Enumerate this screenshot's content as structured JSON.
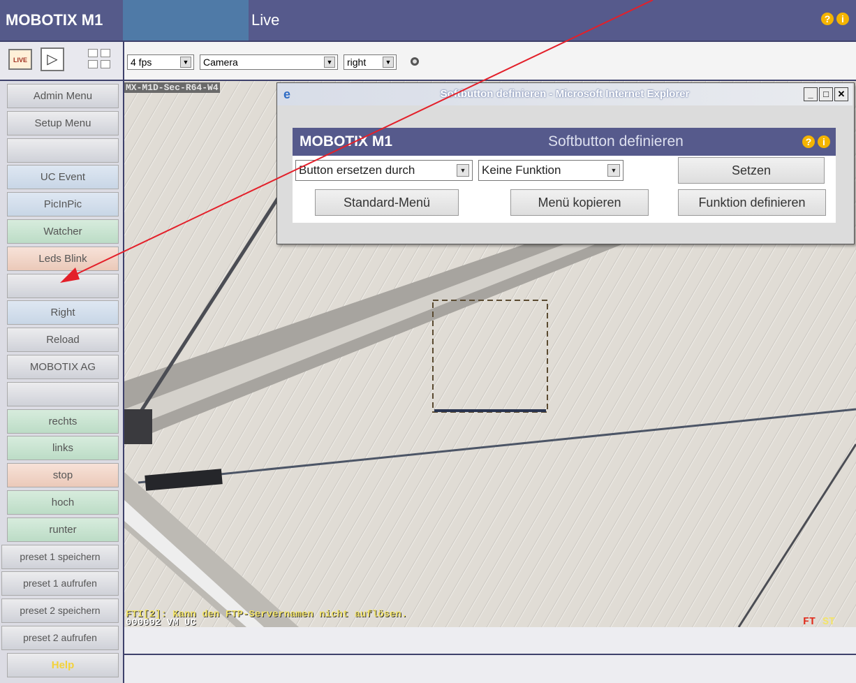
{
  "header": {
    "brand": "MOBOTIX M1",
    "title": "Live",
    "icons": [
      "help-icon",
      "info-icon"
    ]
  },
  "toolbar": {
    "live_label": "LIVE",
    "fps": "4 fps",
    "source": "Camera",
    "position": "right"
  },
  "sidebar": {
    "items": [
      {
        "label": "Admin Menu",
        "style": "gray"
      },
      {
        "label": "Setup Menu",
        "style": "gray"
      },
      {
        "label": "",
        "style": "gray"
      },
      {
        "label": "UC Event",
        "style": "blue"
      },
      {
        "label": "PicInPic",
        "style": "blue"
      },
      {
        "label": "Watcher",
        "style": "green"
      },
      {
        "label": "Leds Blink",
        "style": "pink"
      },
      {
        "label": "",
        "style": "gray"
      },
      {
        "label": "Right",
        "style": "blue"
      },
      {
        "label": "Reload",
        "style": "gray"
      },
      {
        "label": "MOBOTIX AG",
        "style": "gray"
      },
      {
        "label": "",
        "style": "gray"
      },
      {
        "label": "rechts",
        "style": "green"
      },
      {
        "label": "links",
        "style": "green"
      },
      {
        "label": "stop",
        "style": "pink"
      },
      {
        "label": "hoch",
        "style": "green"
      },
      {
        "label": "runter",
        "style": "green"
      },
      {
        "label": "preset 1 speichern",
        "style": "gray"
      },
      {
        "label": "preset 1 aufrufen",
        "style": "gray"
      },
      {
        "label": "preset 2 speichern",
        "style": "gray"
      },
      {
        "label": "preset 2 aufrufen",
        "style": "gray"
      },
      {
        "label": "Help",
        "style": "gray"
      }
    ]
  },
  "video": {
    "osd_top": "MX-M1D-Sec-R64-W4",
    "osd_message": "FTI[2]: Kann den FTP-Servernamen nicht auflösen.",
    "osd_sub": "000002 VM UC",
    "osd_ft": "FT",
    "osd_st": "ST"
  },
  "popup": {
    "window_title": "Softbutton definieren - Microsoft Internet Explorer",
    "brand": "MOBOTIX M1",
    "title": "Softbutton definieren",
    "select_action": "Button ersetzen durch",
    "select_function": "Keine Funktion",
    "set_label": "Setzen",
    "standard_menu_label": "Standard-Menü",
    "copy_menu_label": "Menü kopieren",
    "define_function_label": "Funktion definieren"
  },
  "colors": {
    "header_bg": "#565a8c",
    "accent_blue": "#4f7aa7",
    "annotation_arrow": "#e3202a",
    "icon_yellow": "#f4b400"
  }
}
